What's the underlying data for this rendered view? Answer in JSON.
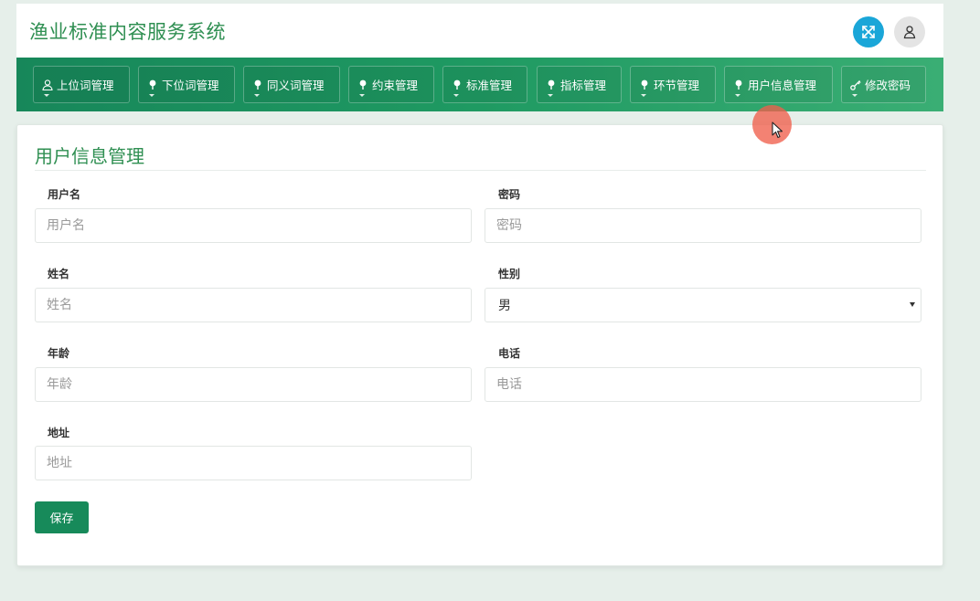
{
  "header": {
    "title": "渔业标准内容服务系统",
    "fullscreen_icon": "expand-icon",
    "user_icon": "user-icon"
  },
  "nav": {
    "items": [
      {
        "label": "上位词管理",
        "icon": "user-icon"
      },
      {
        "label": "下位词管理",
        "icon": "leaf-icon"
      },
      {
        "label": "同义词管理",
        "icon": "leaf-icon"
      },
      {
        "label": "约束管理",
        "icon": "leaf-icon"
      },
      {
        "label": "标准管理",
        "icon": "leaf-icon"
      },
      {
        "label": "指标管理",
        "icon": "leaf-icon"
      },
      {
        "label": "环节管理",
        "icon": "leaf-icon"
      },
      {
        "label": "用户信息管理",
        "icon": "leaf-icon"
      },
      {
        "label": "修改密码",
        "icon": "key-icon"
      }
    ]
  },
  "form": {
    "title": "用户信息管理",
    "username": {
      "label": "用户名",
      "placeholder": "用户名",
      "value": ""
    },
    "password": {
      "label": "密码",
      "placeholder": "密码",
      "value": ""
    },
    "name": {
      "label": "姓名",
      "placeholder": "姓名",
      "value": ""
    },
    "gender": {
      "label": "性别",
      "selected": "男"
    },
    "age": {
      "label": "年龄",
      "placeholder": "年龄",
      "value": ""
    },
    "phone": {
      "label": "电话",
      "placeholder": "电话",
      "value": ""
    },
    "address": {
      "label": "地址",
      "placeholder": "地址",
      "value": ""
    },
    "save_label": "保存"
  },
  "colors": {
    "brand": "#2f8f52",
    "nav_start": "#17875a",
    "nav_end": "#3aae74",
    "fullscreen_button": "#1aa6d8",
    "save_button": "#178a5a",
    "cursor_marker": "#f05f4b"
  }
}
